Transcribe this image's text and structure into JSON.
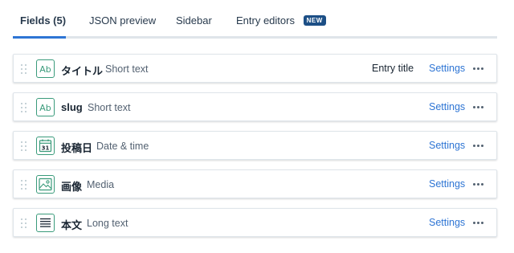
{
  "tabs": [
    {
      "label": "Fields (5)",
      "active": true
    },
    {
      "label": "JSON preview",
      "active": false
    },
    {
      "label": "Sidebar",
      "active": false
    },
    {
      "label": "Entry editors",
      "active": false,
      "badge": "NEW"
    }
  ],
  "fields": [
    {
      "name": "タイトル",
      "type": "Short text",
      "icon": "short-text-icon",
      "entry_title": "Entry title",
      "settings": "Settings"
    },
    {
      "name": "slug",
      "type": "Short text",
      "icon": "short-text-icon",
      "settings": "Settings"
    },
    {
      "name": "投稿日",
      "type": "Date & time",
      "icon": "calendar-icon",
      "icon_text": "31",
      "settings": "Settings"
    },
    {
      "name": "画像",
      "type": "Media",
      "icon": "image-icon",
      "settings": "Settings"
    },
    {
      "name": "本文",
      "type": "Long text",
      "icon": "long-text-icon",
      "settings": "Settings"
    }
  ],
  "icon_text": {
    "short_text": "Ab"
  },
  "colors": {
    "accent": "#2e75d4",
    "field_icon": "#3a9b7b",
    "badge": "#1c4f86",
    "border": "#dfe5ea"
  }
}
